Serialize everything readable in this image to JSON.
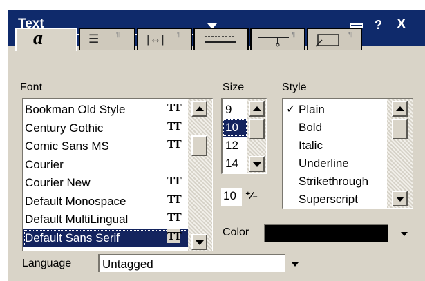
{
  "window": {
    "title": "Text",
    "help_label": "?",
    "close_label": "X"
  },
  "tabs": [
    {
      "name": "Font",
      "glyph": "a"
    },
    {
      "name": "Alignment",
      "glyph": "≡"
    },
    {
      "name": "Spacing",
      "glyph": "↔"
    },
    {
      "name": "Rules",
      "glyph": "—"
    },
    {
      "name": "Tabs",
      "glyph": "⊤"
    },
    {
      "name": "Frame",
      "glyph": "▭"
    }
  ],
  "font_panel": {
    "label": "Font",
    "items": [
      {
        "name": "Bookman Old Style",
        "truetype": true
      },
      {
        "name": "Century Gothic",
        "truetype": true
      },
      {
        "name": "Comic Sans MS",
        "truetype": true
      },
      {
        "name": "Courier",
        "truetype": false
      },
      {
        "name": "Courier New",
        "truetype": true
      },
      {
        "name": "Default Monospace",
        "truetype": true
      },
      {
        "name": "Default MultiLingual",
        "truetype": true
      },
      {
        "name": "Default Sans Serif",
        "truetype": true
      }
    ],
    "selected": "Default Sans Serif",
    "truetype_glyph": "TT"
  },
  "size_panel": {
    "label": "Size",
    "items": [
      "9",
      "10",
      "12",
      "14"
    ],
    "selected": "10",
    "custom_value": "10"
  },
  "style_panel": {
    "label": "Style",
    "items": [
      "Plain",
      "Bold",
      "Italic",
      "Underline",
      "Strikethrough",
      "Superscript"
    ],
    "checked": "Plain"
  },
  "color": {
    "label": "Color",
    "value_hex": "#000000"
  },
  "language": {
    "label": "Language",
    "value": "Untagged"
  }
}
